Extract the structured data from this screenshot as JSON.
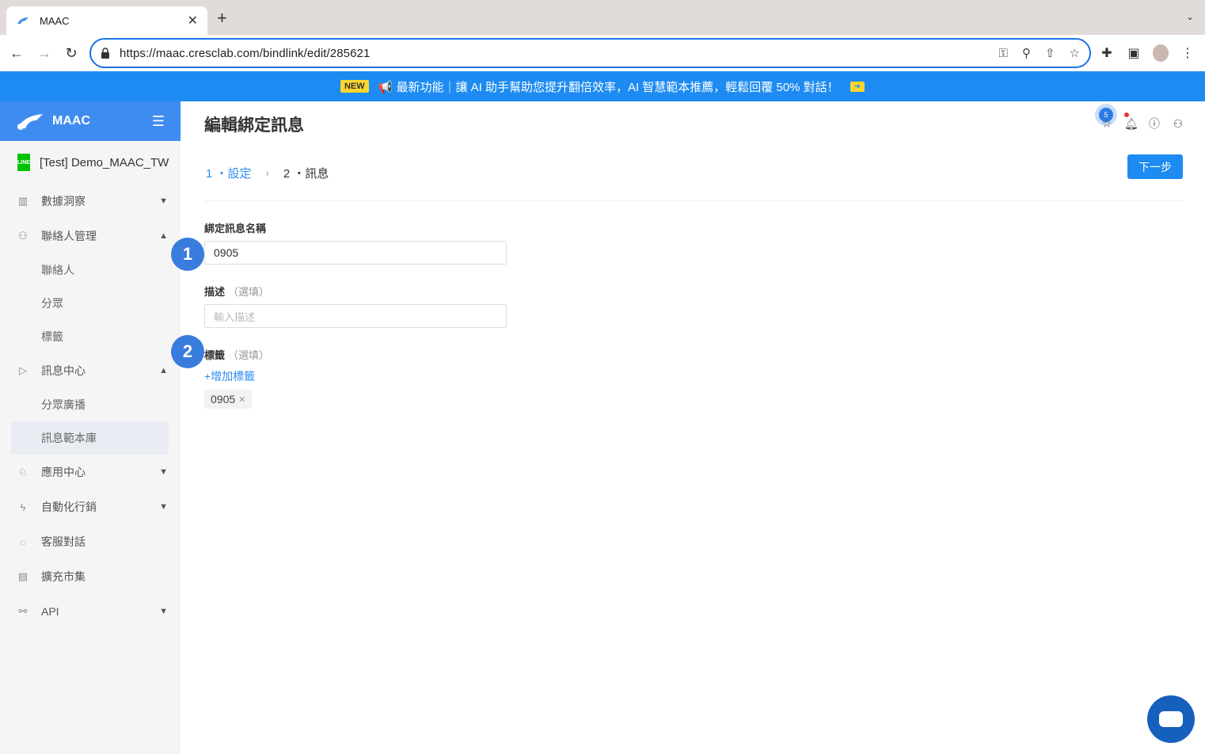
{
  "browser": {
    "tab_title": "MAAC",
    "url": "https://maac.cresclab.com/bindlink/edit/285621"
  },
  "banner": {
    "badge": "NEW",
    "text": "📢 最新功能｜讓 AI 助手幫助您提升翻倍效率，AI 智慧範本推薦，輕鬆回覆 50% 對話！"
  },
  "sidebar": {
    "brand": "MAAC",
    "channel_badge": "LINE",
    "channel_name": "[Test] Demo_MAAC_TW",
    "items": [
      {
        "label": "數據洞察"
      },
      {
        "label": "聯絡人管理"
      },
      {
        "label": "聯絡人"
      },
      {
        "label": "分眾"
      },
      {
        "label": "標籤"
      },
      {
        "label": "訊息中心"
      },
      {
        "label": "分眾廣播"
      },
      {
        "label": "訊息範本庫"
      },
      {
        "label": "應用中心"
      },
      {
        "label": "自動化行銷"
      },
      {
        "label": "客服對話"
      },
      {
        "label": "擴充市集"
      },
      {
        "label": "API"
      }
    ]
  },
  "main": {
    "title": "編輯綁定訊息",
    "notification_count": "5",
    "steps": {
      "step1": "1 ・設定",
      "step2": "2 ・訊息"
    },
    "next_button": "下一步",
    "name_label": "綁定訊息名稱",
    "name_value": "0905",
    "desc_label": "描述",
    "desc_optional": "（選填）",
    "desc_placeholder": "輸入描述",
    "tag_label": "標籤",
    "tag_optional": "（選填）",
    "add_tag": "+增加標籤",
    "tags": [
      "0905"
    ]
  },
  "markers": [
    "1",
    "2"
  ]
}
